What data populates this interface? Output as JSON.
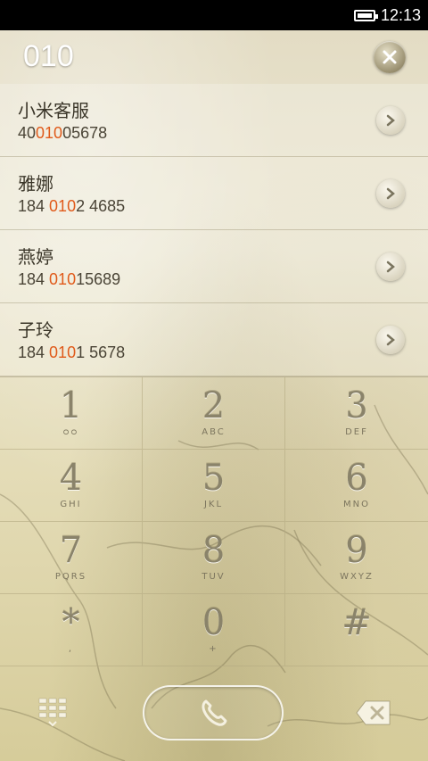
{
  "status_bar": {
    "time": "12:13",
    "battery_icon": "battery-full-icon"
  },
  "dialer": {
    "input_value": "010",
    "clear_icon": "close-icon"
  },
  "contacts": [
    {
      "name": "小米客服",
      "number_before": "40",
      "number_match": "010",
      "number_after": "05678"
    },
    {
      "name": "雅娜",
      "number_before": "184 ",
      "number_match": "010",
      "number_after": "2 4685"
    },
    {
      "name": "燕婷",
      "number_before": "184 ",
      "number_match": "010",
      "number_after": "15689"
    },
    {
      "name": "子玲",
      "number_before": "184 ",
      "number_match": "010",
      "number_after": "1 5678"
    }
  ],
  "keypad": {
    "keys": [
      {
        "digit": "1",
        "letters": "◦◦"
      },
      {
        "digit": "2",
        "letters": "ABC"
      },
      {
        "digit": "3",
        "letters": "DEF"
      },
      {
        "digit": "4",
        "letters": "GHI"
      },
      {
        "digit": "5",
        "letters": "JKL"
      },
      {
        "digit": "6",
        "letters": "MNO"
      },
      {
        "digit": "7",
        "letters": "PQRS"
      },
      {
        "digit": "8",
        "letters": "TUV"
      },
      {
        "digit": "9",
        "letters": "WXYZ"
      },
      {
        "digit": "*",
        "letters": ","
      },
      {
        "digit": "0",
        "letters": "+"
      },
      {
        "digit": "#",
        "letters": ""
      }
    ]
  },
  "bottom_bar": {
    "left_icon": "dialpad-icon",
    "call_icon": "phone-icon",
    "right_icon": "backspace-icon"
  },
  "colors": {
    "highlight": "#e05a1a",
    "paper": "#e8e2c8"
  }
}
